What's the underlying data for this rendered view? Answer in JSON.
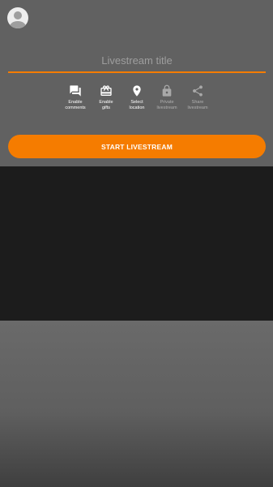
{
  "header": {
    "avatar_icon": "account-circle-icon"
  },
  "title_field": {
    "placeholder": "Livestream title",
    "value": ""
  },
  "options": [
    {
      "icon": "comments-icon",
      "label": "Enable\ncomments",
      "enabled": true
    },
    {
      "icon": "gift-icon",
      "label": "Enable\ngifts",
      "enabled": true
    },
    {
      "icon": "location-pin-icon",
      "label": "Select\nlocation",
      "enabled": true
    },
    {
      "icon": "lock-icon",
      "label": "Private\nlivestream",
      "enabled": false
    },
    {
      "icon": "share-icon",
      "label": "Share\nlivestream",
      "enabled": false
    }
  ],
  "start_button": {
    "label": "START LIVESTREAM"
  },
  "colors": {
    "accent": "#f57c00",
    "panel": "#616161",
    "preview": "#1c1c1c",
    "enabled_label": "#ffffff",
    "disabled_label": "#b0b0b0"
  }
}
